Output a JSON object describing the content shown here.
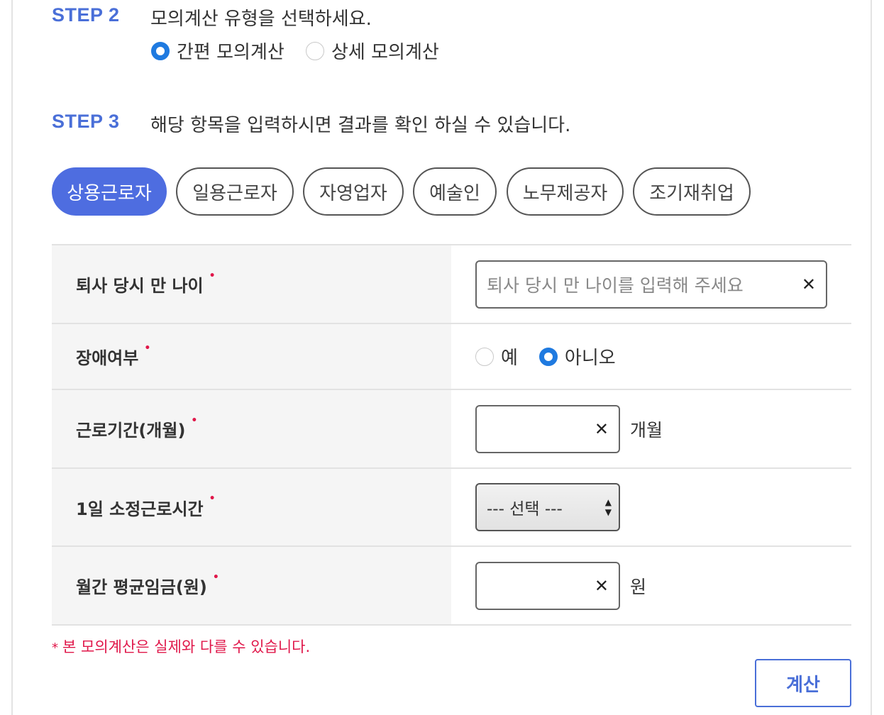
{
  "step2": {
    "label": "STEP 2",
    "description": "모의계산 유형을 선택하세요.",
    "options": [
      {
        "label": "간편 모의계산",
        "checked": true
      },
      {
        "label": "상세 모의계산",
        "checked": false
      }
    ]
  },
  "step3": {
    "label": "STEP 3",
    "description": "해당 항목을 입력하시면 결과를 확인 하실 수 있습니다."
  },
  "tabs": [
    {
      "label": "상용근로자",
      "active": true
    },
    {
      "label": "일용근로자",
      "active": false
    },
    {
      "label": "자영업자",
      "active": false
    },
    {
      "label": "예술인",
      "active": false
    },
    {
      "label": "노무제공자",
      "active": false
    },
    {
      "label": "조기재취업",
      "active": false
    }
  ],
  "form": {
    "age": {
      "label": "퇴사 당시 만 나이",
      "placeholder": "퇴사 당시 만 나이를 입력해 주세요",
      "value": ""
    },
    "disability": {
      "label": "장애여부",
      "options": [
        {
          "label": "예",
          "checked": false
        },
        {
          "label": "아니오",
          "checked": true
        }
      ]
    },
    "work_period": {
      "label": "근로기간(개월)",
      "value": "",
      "unit": "개월"
    },
    "daily_hours": {
      "label": "1일 소정근로시간",
      "selected": "--- 선택 ---"
    },
    "monthly_wage": {
      "label": "월간 평균임금(원)",
      "value": "",
      "unit": "원"
    },
    "required_mark": "•"
  },
  "note": {
    "star": "*",
    "text": "본 모의계산은 실제와 다를 수 있습니다."
  },
  "calc_button": "계산",
  "colors": {
    "accent": "#4e6de0",
    "required": "#e0174a",
    "radio": "#1f7ae0"
  }
}
